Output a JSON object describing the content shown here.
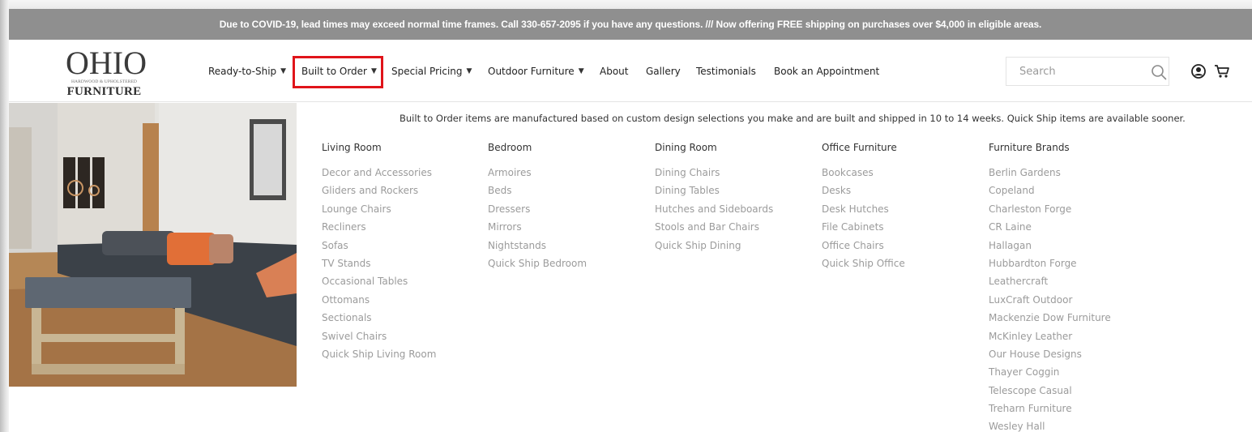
{
  "banner": {
    "text": "Due to COVID-19, lead times may exceed normal time frames. Call 330-657-2095 if you have any questions. /// Now offering FREE shipping on purchases over $4,000 in eligible areas."
  },
  "logo": {
    "word": "OHIO",
    "tagline": "HARDWOOD & UPHOLSTERED",
    "subword": "FURNITURE"
  },
  "nav": {
    "items": [
      {
        "label": "Ready-to-Ship",
        "dropdown": true
      },
      {
        "label": "Built to Order",
        "dropdown": true,
        "active": true
      },
      {
        "label": "Special Pricing",
        "dropdown": true
      },
      {
        "label": "Outdoor Furniture",
        "dropdown": true
      },
      {
        "label": "About",
        "dropdown": false
      },
      {
        "label": "Gallery",
        "dropdown": false
      },
      {
        "label": "Testimonials",
        "dropdown": false
      },
      {
        "label": "Book an Appointment",
        "dropdown": false
      }
    ]
  },
  "search": {
    "placeholder": "Search",
    "icon": "search-icon"
  },
  "header_icons": [
    "user-icon",
    "cart-icon"
  ],
  "colors": {
    "banner_bg": "#8f8f8f",
    "highlight": "#e0141a",
    "menu_link": "#9b9b9b",
    "heading": "#333333"
  },
  "megamenu": {
    "intro": "Built to Order items are manufactured based on custom design selections you make and are built and shipped in 10 to 14 weeks. Quick Ship items are available sooner.",
    "columns": [
      {
        "heading": "Living Room",
        "items": [
          "Decor and Accessories",
          "Gliders and Rockers",
          "Lounge Chairs",
          "Recliners",
          "Sofas",
          "TV Stands",
          "Occasional Tables",
          "Ottomans",
          "Sectionals",
          "Swivel Chairs",
          "Quick Ship Living Room"
        ]
      },
      {
        "heading": "Bedroom",
        "items": [
          "Armoires",
          "Beds",
          "Dressers",
          "Mirrors",
          "Nightstands",
          "Quick Ship Bedroom"
        ]
      },
      {
        "heading": "Dining Room",
        "items": [
          "Dining Chairs",
          "Dining Tables",
          "Hutches and Sideboards",
          "Stools and Bar Chairs",
          "Quick Ship Dining"
        ]
      },
      {
        "heading": "Office Furniture",
        "items": [
          "Bookcases",
          "Desks",
          "Desk Hutches",
          "File Cabinets",
          "Office Chairs",
          "Quick Ship Office"
        ]
      },
      {
        "heading": "Furniture Brands",
        "items": [
          "Berlin Gardens",
          "Copeland",
          "Charleston Forge",
          "CR Laine",
          "Hallagan",
          "Hubbardton Forge",
          "Leathercraft",
          "LuxCraft Outdoor",
          "Mackenzie Dow Furniture",
          "McKinley Leather",
          "Our House Designs",
          "Thayer Coggin",
          "Telescope Casual",
          "Treharn Furniture",
          "Wesley Hall"
        ]
      }
    ]
  }
}
